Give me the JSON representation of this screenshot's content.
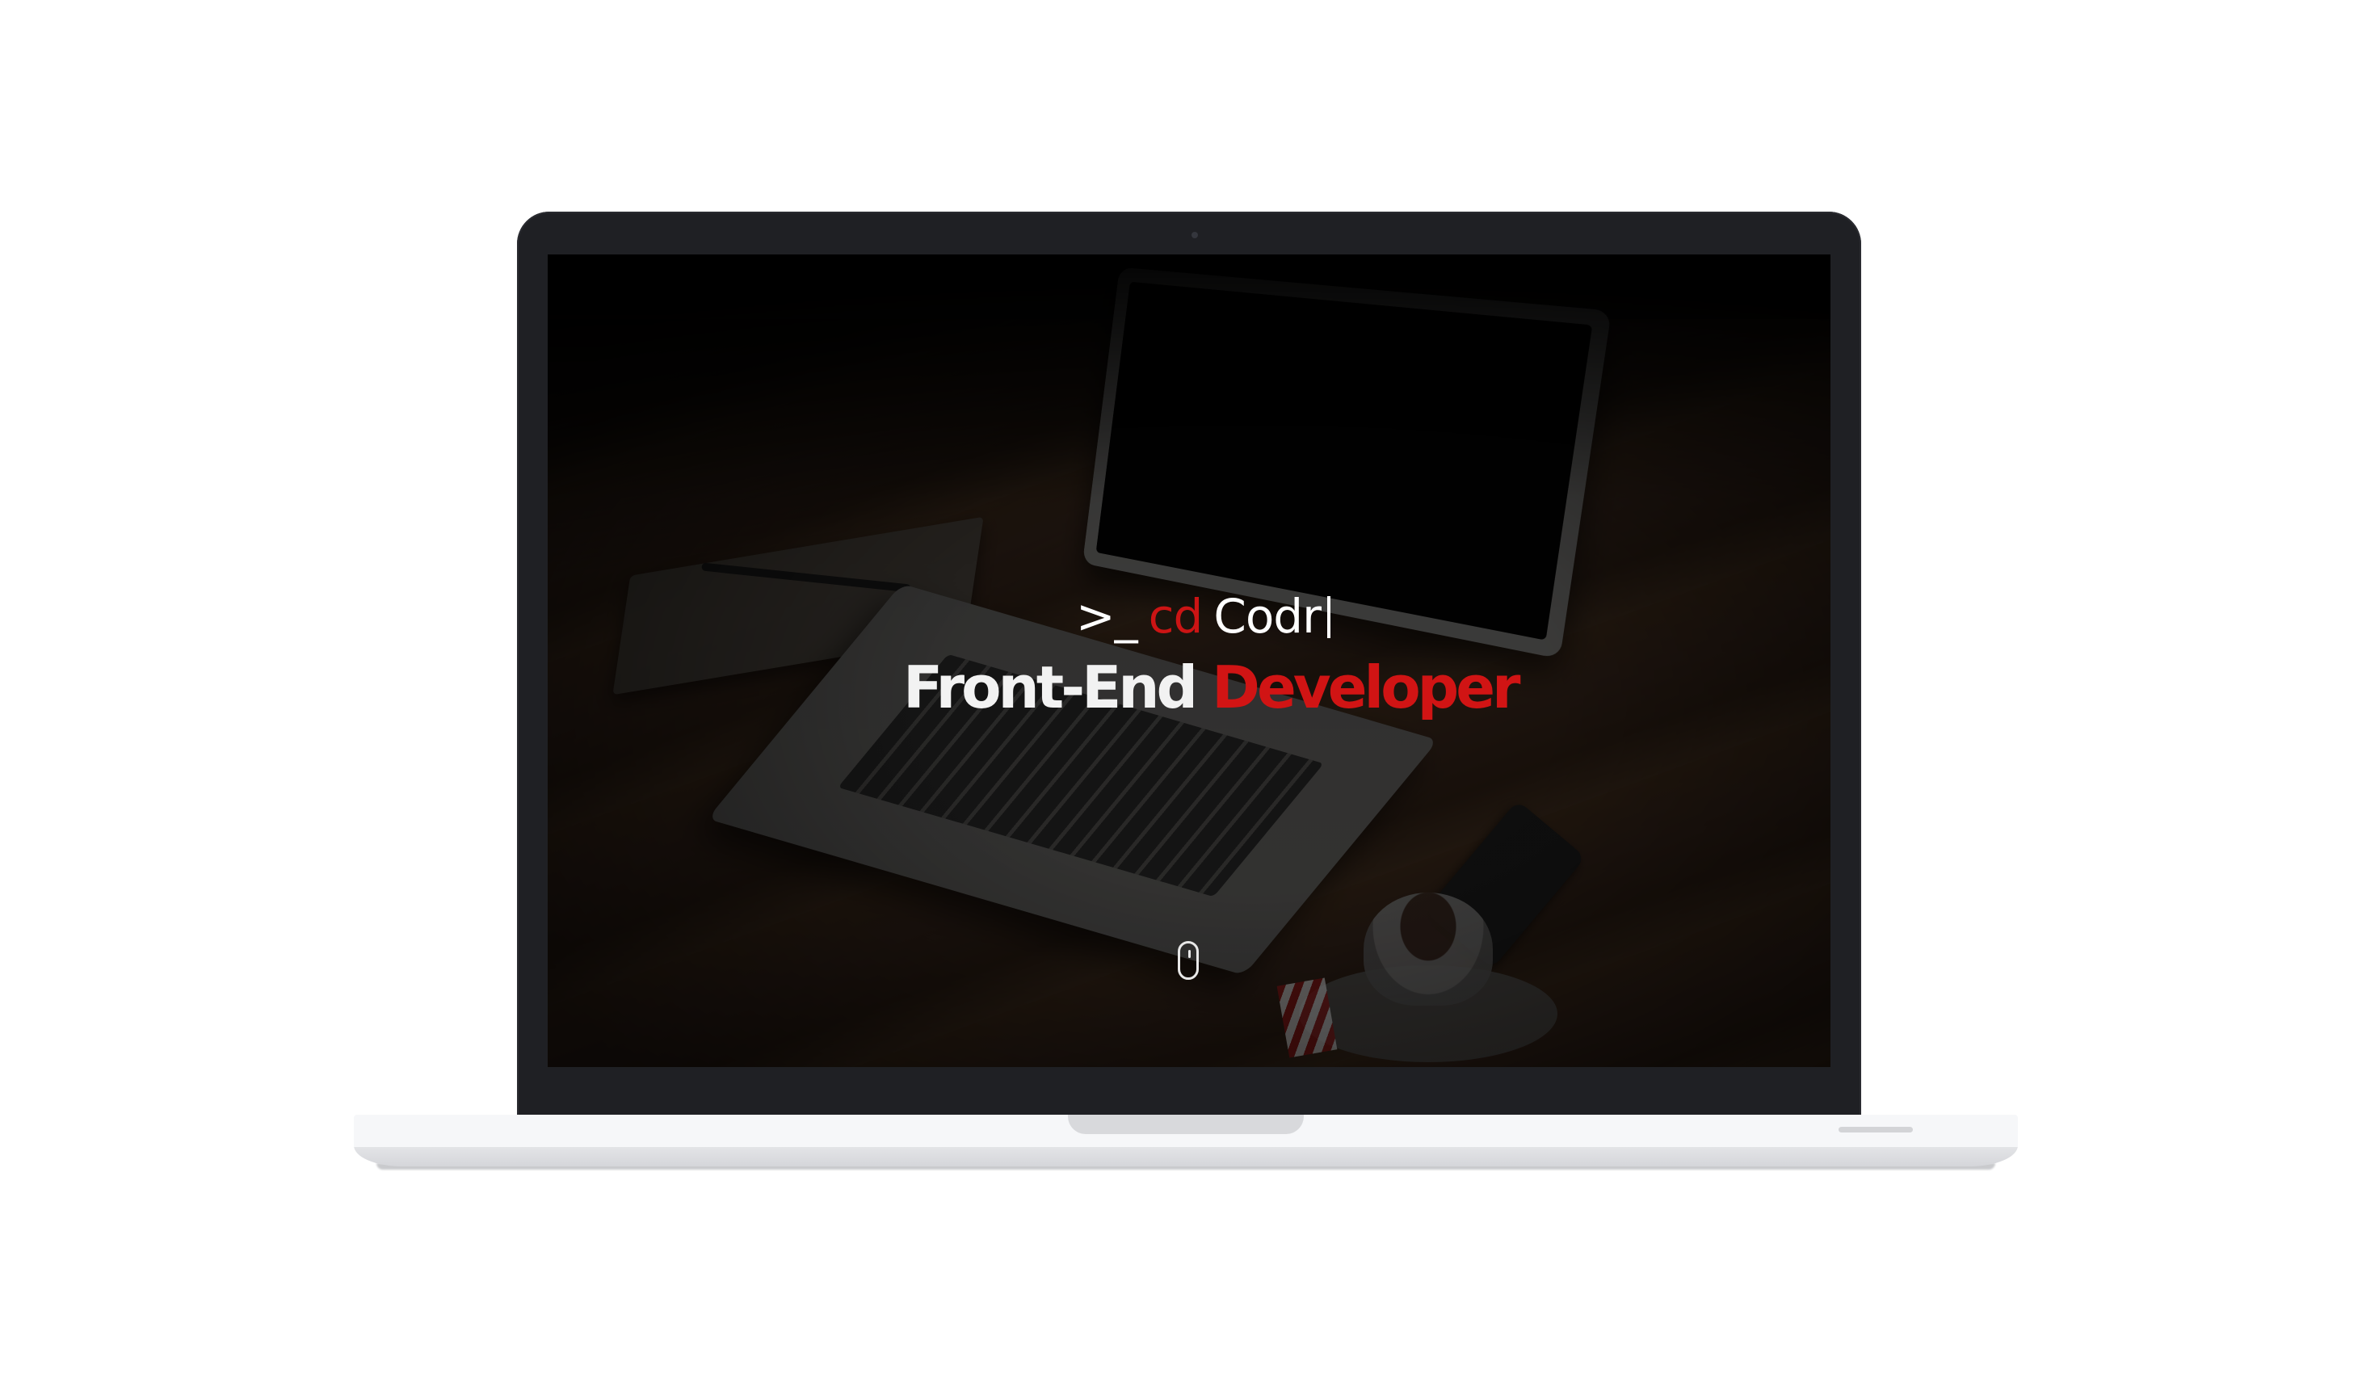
{
  "hero": {
    "prompt_symbol": ">_",
    "prompt_command": "cd",
    "prompt_name": "Codr",
    "headline_part1": "Front-End",
    "headline_part2": "Developer"
  },
  "icons": {
    "scroll": "scroll-mouse-icon"
  },
  "colors": {
    "accent": "#cc1414",
    "text": "#ffffff",
    "device_bezel": "#1f2024",
    "device_base": "#f6f7f9"
  }
}
